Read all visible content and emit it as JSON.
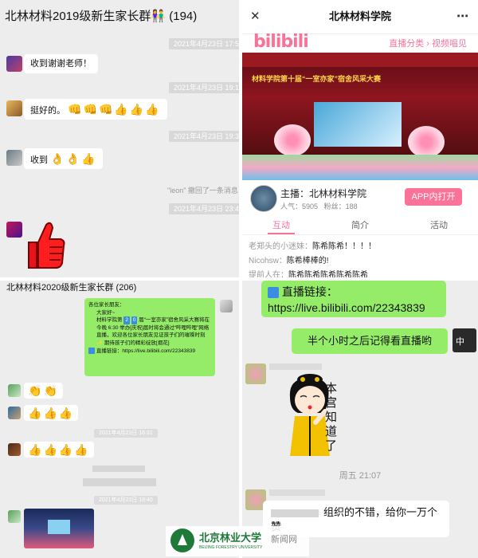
{
  "panel1": {
    "title": "北林材料2019级新生家长群",
    "title_emoji": "👫",
    "member_count": "(194)",
    "timestamps": [
      "2021年4月23日 17:57",
      "2021年4月23日 19:10",
      "2021年4月23日 19:3",
      "2021年4月23日 23:40"
    ],
    "messages": [
      {
        "text": "收到谢谢老师！"
      },
      {
        "text": "挺好的。",
        "emojis": [
          "👊",
          "👊",
          "👊",
          "👍",
          "👍",
          "👍"
        ]
      },
      {
        "text": "收到",
        "emojis": [
          "👌",
          "👌",
          "👍"
        ]
      }
    ],
    "recall_notice": "\"leon\" 撤回了一条消息",
    "thumb_sticker": "👍"
  },
  "panel2": {
    "close_icon": "✕",
    "title": "北林材料学院",
    "more_icon": "⋯",
    "logo_text": "bilibili",
    "breadcrumb": "直播分类 › 视频唱见",
    "video_banner": "材料学院第十届“一室亦家”宿舍风采大赛",
    "host_label": "主播：北林材料学院",
    "popularity_label": "人气：",
    "popularity_value": "5905",
    "followers_label": "粉丝：",
    "followers_value": "188",
    "open_app_button": "APP内打开",
    "tabs": [
      "互动",
      "简介",
      "活动"
    ],
    "comments": [
      {
        "user": "老郑头的小迷妹：",
        "text": "陈希陈希！！！！"
      },
      {
        "user": "Nicohsw：",
        "text": "陈希棒棒的!"
      },
      {
        "user": "提前人在：",
        "text": "陈希陈希陈希陈希陈希"
      }
    ]
  },
  "panel3": {
    "title": "北林材料2020级新生家长群",
    "member_count": "(206)",
    "announcement": {
      "greeting": "各位家长朋友：",
      "line2": "大家好~",
      "body_prefix": "材料学院第",
      "body_num1": "2",
      "body_num2": "0",
      "body_rest": "届“一室亦家”宿舍风采大赛将在今晚 6:30 举办[庆祝]届时将会通过“哔哩哔哩”网络直播，欢迎各位家长朋友见证孩子们的璀璨时刻✨ 期待孩子们的精彩绽放[烟花]",
      "link_label": "直播链接：",
      "link_url": "https://live.bilibili.com/22343839"
    },
    "timestamps": [
      "2021年4月23日 16:31",
      "2021年4月23日 18:40"
    ],
    "emoji_rows": [
      [
        "👏",
        "👏"
      ],
      [
        "👍",
        "👍",
        "👍"
      ],
      [
        "👍",
        "👍",
        "👍",
        "👍"
      ]
    ]
  },
  "panel4": {
    "link_label": "直播链接：",
    "link_url": "https://live.bilibili.com/22343839",
    "reminder": "半个小时之后记得看直播哟",
    "avatar_char": "中",
    "sticker_text": "本宫知道了",
    "day_time": "周五 21:07",
    "praise": "组织的不错，给你一万个赞"
  },
  "watermark": {
    "school_cn": "北京林业大学",
    "school_en": "BEIJING FORESTRY UNIVERSITY",
    "site": "新闻网"
  },
  "colors": {
    "wechat_green": "#95ec69",
    "bili_pink": "#fb7299",
    "chat_bg": "#ededed"
  }
}
